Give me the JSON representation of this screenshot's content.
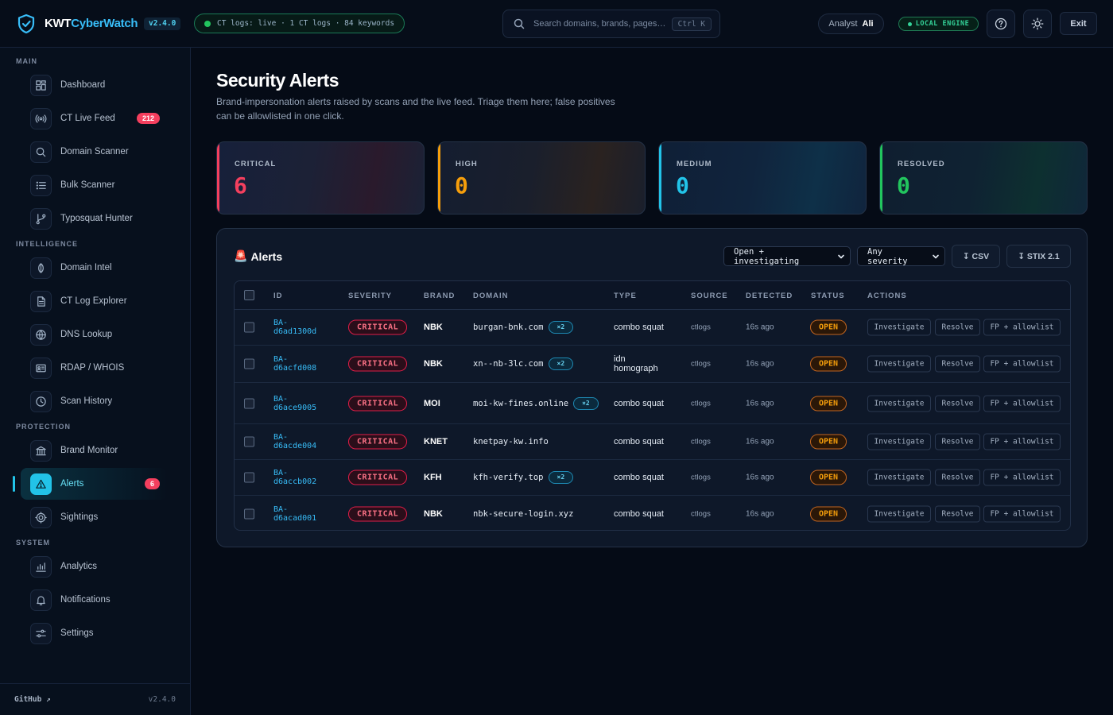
{
  "header": {
    "brand_part1": "KWT",
    "brand_part2": "CyberWatch",
    "version": "v2.4.0",
    "feed_status": "CT logs: live · 1 CT logs · 84 keywords",
    "search_placeholder": "Search domains, brands, pages…",
    "search_shortcut": "Ctrl K",
    "analyst_label": "Analyst",
    "analyst_name": "Ali",
    "engine_label": "LOCAL ENGINE",
    "exit_label": "Exit"
  },
  "sidebar": {
    "sections": {
      "main": "MAIN",
      "intelligence": "INTELLIGENCE",
      "protection": "PROTECTION",
      "system": "SYSTEM"
    },
    "items": [
      {
        "label": "Dashboard",
        "icon": "dashboard-icon"
      },
      {
        "label": "CT Live Feed",
        "icon": "broadcast-icon",
        "count": "212"
      },
      {
        "label": "Domain Scanner",
        "icon": "search-icon"
      },
      {
        "label": "Bulk Scanner",
        "icon": "list-icon"
      },
      {
        "label": "Typosquat Hunter",
        "icon": "branch-icon"
      },
      {
        "label": "Domain Intel",
        "icon": "intel-icon"
      },
      {
        "label": "CT Log Explorer",
        "icon": "document-icon"
      },
      {
        "label": "DNS Lookup",
        "icon": "globe-icon"
      },
      {
        "label": "RDAP / WHOIS",
        "icon": "id-card-icon"
      },
      {
        "label": "Scan History",
        "icon": "clock-icon"
      },
      {
        "label": "Brand Monitor",
        "icon": "bank-icon"
      },
      {
        "label": "Alerts",
        "icon": "warning-icon",
        "count": "6",
        "active": true
      },
      {
        "label": "Sightings",
        "icon": "target-icon"
      },
      {
        "label": "Analytics",
        "icon": "bar-chart-icon"
      },
      {
        "label": "Notifications",
        "icon": "bell-icon"
      },
      {
        "label": "Settings",
        "icon": "sliders-icon"
      }
    ],
    "footer_link": "GitHub ↗",
    "footer_version": "v2.4.0"
  },
  "page": {
    "title": "Security Alerts",
    "subtitle": "Brand-impersonation alerts raised by scans and the live feed. Triage them here; false positives can be allowlisted in one click."
  },
  "stats": [
    {
      "label": "CRITICAL",
      "value": "6",
      "color": "#f43f5e"
    },
    {
      "label": "HIGH",
      "value": "0",
      "color": "#f59e0b"
    },
    {
      "label": "MEDIUM",
      "value": "0",
      "color": "#22c3e8"
    },
    {
      "label": "RESOLVED",
      "value": "0",
      "color": "#22c55e"
    }
  ],
  "alerts_panel": {
    "title_emoji": "🚨",
    "title": "Alerts",
    "status_filter": "Open + investigating",
    "severity_filter": "Any severity",
    "csv_label": "↧ CSV",
    "stix_label": "↧ STIX 2.1",
    "columns": [
      "ID",
      "SEVERITY",
      "BRAND",
      "DOMAIN",
      "TYPE",
      "SOURCE",
      "DETECTED",
      "STATUS",
      "ACTIONS"
    ],
    "action_labels": [
      "Investigate",
      "Resolve",
      "FP + allowlist"
    ],
    "rows": [
      {
        "id_line1": "BA-",
        "id_line2": "d6ad1300d",
        "severity": "CRITICAL",
        "brand": "NBK",
        "domain": "burgan-bnk.com",
        "tag": "×2",
        "type_line1": "combo squat",
        "type_line2": "",
        "source": "ctlogs",
        "detected": "16s ago",
        "status": "OPEN"
      },
      {
        "id_line1": "BA-",
        "id_line2": "d6acfd008",
        "severity": "CRITICAL",
        "brand": "NBK",
        "domain": "xn--nb-3lc.com",
        "tag": "×2",
        "type_line1": "idn",
        "type_line2": "homograph",
        "source": "ctlogs",
        "detected": "16s ago",
        "status": "OPEN"
      },
      {
        "id_line1": "BA-",
        "id_line2": "d6ace9005",
        "severity": "CRITICAL",
        "brand": "MOI",
        "domain": "moi-kw-fines.online",
        "tag": "×2",
        "type_line1": "combo squat",
        "type_line2": "",
        "source": "ctlogs",
        "detected": "16s ago",
        "status": "OPEN"
      },
      {
        "id_line1": "BA-",
        "id_line2": "d6acde004",
        "severity": "CRITICAL",
        "brand": "KNET",
        "domain": "knetpay-kw.info",
        "tag": "",
        "type_line1": "combo squat",
        "type_line2": "",
        "source": "ctlogs",
        "detected": "16s ago",
        "status": "OPEN"
      },
      {
        "id_line1": "BA-",
        "id_line2": "d6accb002",
        "severity": "CRITICAL",
        "brand": "KFH",
        "domain": "kfh-verify.top",
        "tag": "×2",
        "type_line1": "combo squat",
        "type_line2": "",
        "source": "ctlogs",
        "detected": "16s ago",
        "status": "OPEN"
      },
      {
        "id_line1": "BA-",
        "id_line2": "d6acad001",
        "severity": "CRITICAL",
        "brand": "NBK",
        "domain": "nbk-secure-login.xyz",
        "tag": "",
        "type_line1": "combo squat",
        "type_line2": "",
        "source": "ctlogs",
        "detected": "16s ago",
        "status": "OPEN"
      }
    ]
  }
}
